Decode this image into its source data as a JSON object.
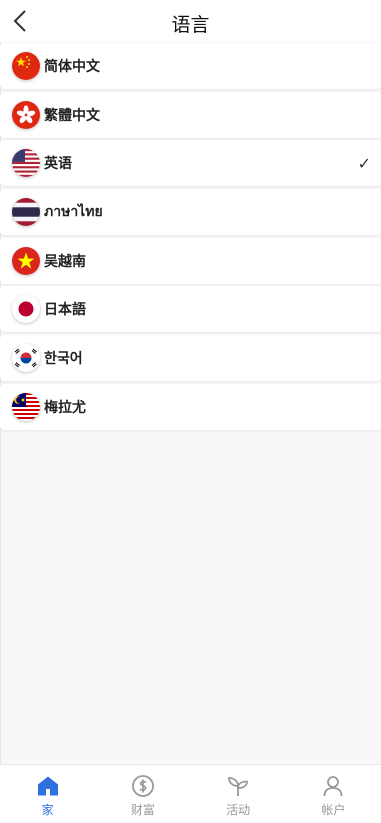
{
  "header": {
    "title": "语言"
  },
  "languages": [
    {
      "label": "简体中文",
      "flag": "china",
      "selected": false
    },
    {
      "label": "繁體中文",
      "flag": "hongkong",
      "selected": false
    },
    {
      "label": "英语",
      "flag": "usa",
      "selected": true
    },
    {
      "label": "ภาษาไทย",
      "flag": "thailand",
      "selected": false
    },
    {
      "label": "吴越南",
      "flag": "vietnam",
      "selected": false
    },
    {
      "label": "日本語",
      "flag": "japan",
      "selected": false
    },
    {
      "label": "한국어",
      "flag": "korea",
      "selected": false
    },
    {
      "label": "梅拉尤",
      "flag": "malaysia",
      "selected": false
    }
  ],
  "check_mark": "✓",
  "tabs": [
    {
      "label": "家",
      "icon": "home-icon",
      "active": true
    },
    {
      "label": "财富",
      "icon": "dollar-coin-icon",
      "active": false
    },
    {
      "label": "活动",
      "icon": "sprout-icon",
      "active": false
    },
    {
      "label": "帐户",
      "icon": "user-icon",
      "active": false
    }
  ],
  "colors": {
    "accent": "#2f6fe0",
    "inactive": "#999999",
    "background": "#f8f8f8"
  }
}
